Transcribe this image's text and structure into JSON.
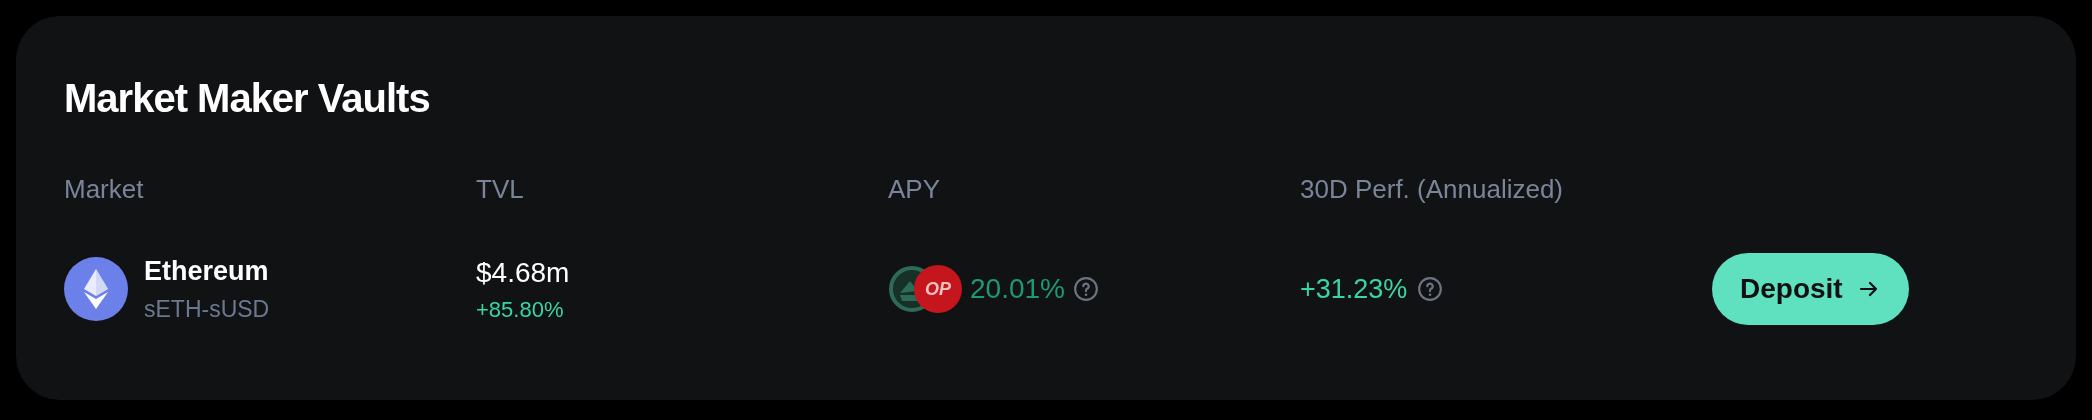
{
  "title": "Market Maker Vaults",
  "table": {
    "columns": [
      "Market",
      "TVL",
      "APY",
      "30D Perf. (Annualized)"
    ],
    "rows": [
      {
        "market": {
          "name": "Ethereum",
          "pair": "sETH-sUSD"
        },
        "tvl": {
          "value": "$4.68m",
          "change": "+85.80%"
        },
        "apy": {
          "badge": "OP",
          "value": "20.01%"
        },
        "perf": "+31.23%",
        "action": "Deposit"
      }
    ]
  }
}
